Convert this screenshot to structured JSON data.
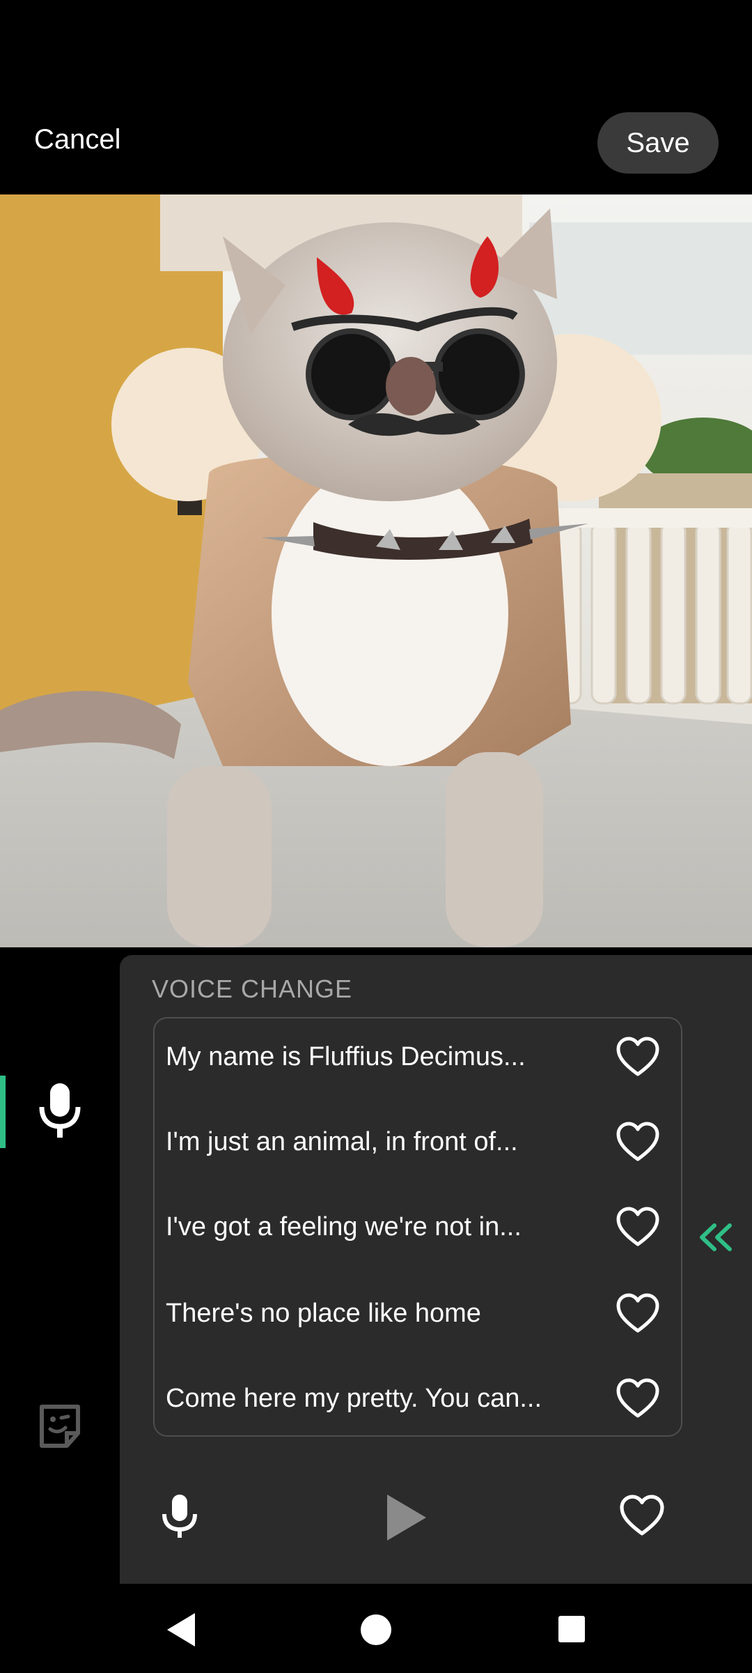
{
  "header": {
    "cancel_label": "Cancel",
    "save_label": "Save"
  },
  "panel": {
    "title": "VOICE CHANGE",
    "items": [
      {
        "text": "My name is Fluffius Decimus..."
      },
      {
        "text": "I'm just an animal, in front of..."
      },
      {
        "text": "I've got a feeling we're not in..."
      },
      {
        "text": "There's no place like home"
      },
      {
        "text": "Come here my pretty. You can..."
      }
    ]
  },
  "icons": {
    "rail": [
      "microphone-icon",
      "sticker-icon"
    ],
    "item": "heart-outline-icon",
    "expand": "double-chevron-left-icon",
    "bottom": [
      "microphone-icon",
      "play-icon",
      "heart-outline-icon"
    ],
    "nav": [
      "back-triangle-icon",
      "home-circle-icon",
      "recents-square-icon"
    ]
  },
  "colors": {
    "accent": "#2fbf86",
    "panel_bg": "#2b2b2b",
    "save_bg": "#3a3a3a",
    "title_gray": "#a8a8a8"
  }
}
